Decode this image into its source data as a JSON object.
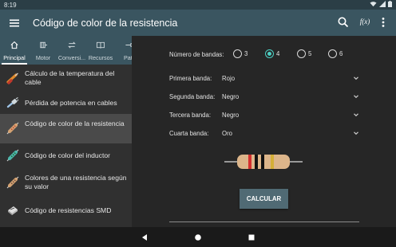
{
  "status": {
    "time": "8:19",
    "icons": [
      "wifi-icon",
      "signal-icon",
      "battery-icon"
    ]
  },
  "appbar": {
    "title": "Código de color de la resistencia",
    "actions": [
      "search-icon",
      "function-icon",
      "more-vert-icon"
    ],
    "function_glyph": "f(x)"
  },
  "tabs": [
    {
      "label": "Principal",
      "icon": "home-icon",
      "active": true
    },
    {
      "label": "Motor",
      "icon": "motor-icon",
      "active": false
    },
    {
      "label": "Conversi...",
      "icon": "convert-icon",
      "active": false
    },
    {
      "label": "Recursos",
      "icon": "book-icon",
      "active": false
    },
    {
      "label": "Patil",
      "icon": "pin-icon",
      "active": false
    }
  ],
  "list": [
    {
      "label": "Cálculo de la temperatura del cable",
      "icon": "cable-icon",
      "selected": false
    },
    {
      "label": "Pérdida de potencia en cables",
      "icon": "plug-icon",
      "selected": false
    },
    {
      "label": "Código de color de la resistencia",
      "icon": "resistor-icon",
      "selected": true
    },
    {
      "label": "Código de color del inductor",
      "icon": "inductor-icon",
      "selected": false
    },
    {
      "label": "Colores de una resistencia según su valor",
      "icon": "resistor-value-icon",
      "selected": false
    },
    {
      "label": "Código de resistencias SMD",
      "icon": "smd-icon",
      "selected": false
    }
  ],
  "form": {
    "bands_label": "Número de bandas:",
    "band_options": [
      "3",
      "4",
      "5",
      "6"
    ],
    "selected_bands": "4",
    "rows": [
      {
        "label": "Primera banda:",
        "value": "Rojo"
      },
      {
        "label": "Segunda banda:",
        "value": "Negro"
      },
      {
        "label": "Tercera banda:",
        "value": "Negro"
      },
      {
        "label": "Cuarta banda:",
        "value": "Oro"
      }
    ],
    "calc_label": "CALCULAR"
  },
  "colors": {
    "appbar": "#3a5560",
    "statusbar": "#2b3e46",
    "accent": "#4dd0c4",
    "band_colors": [
      "#d32f2f",
      "#111111",
      "#111111",
      "#d4af37"
    ]
  }
}
